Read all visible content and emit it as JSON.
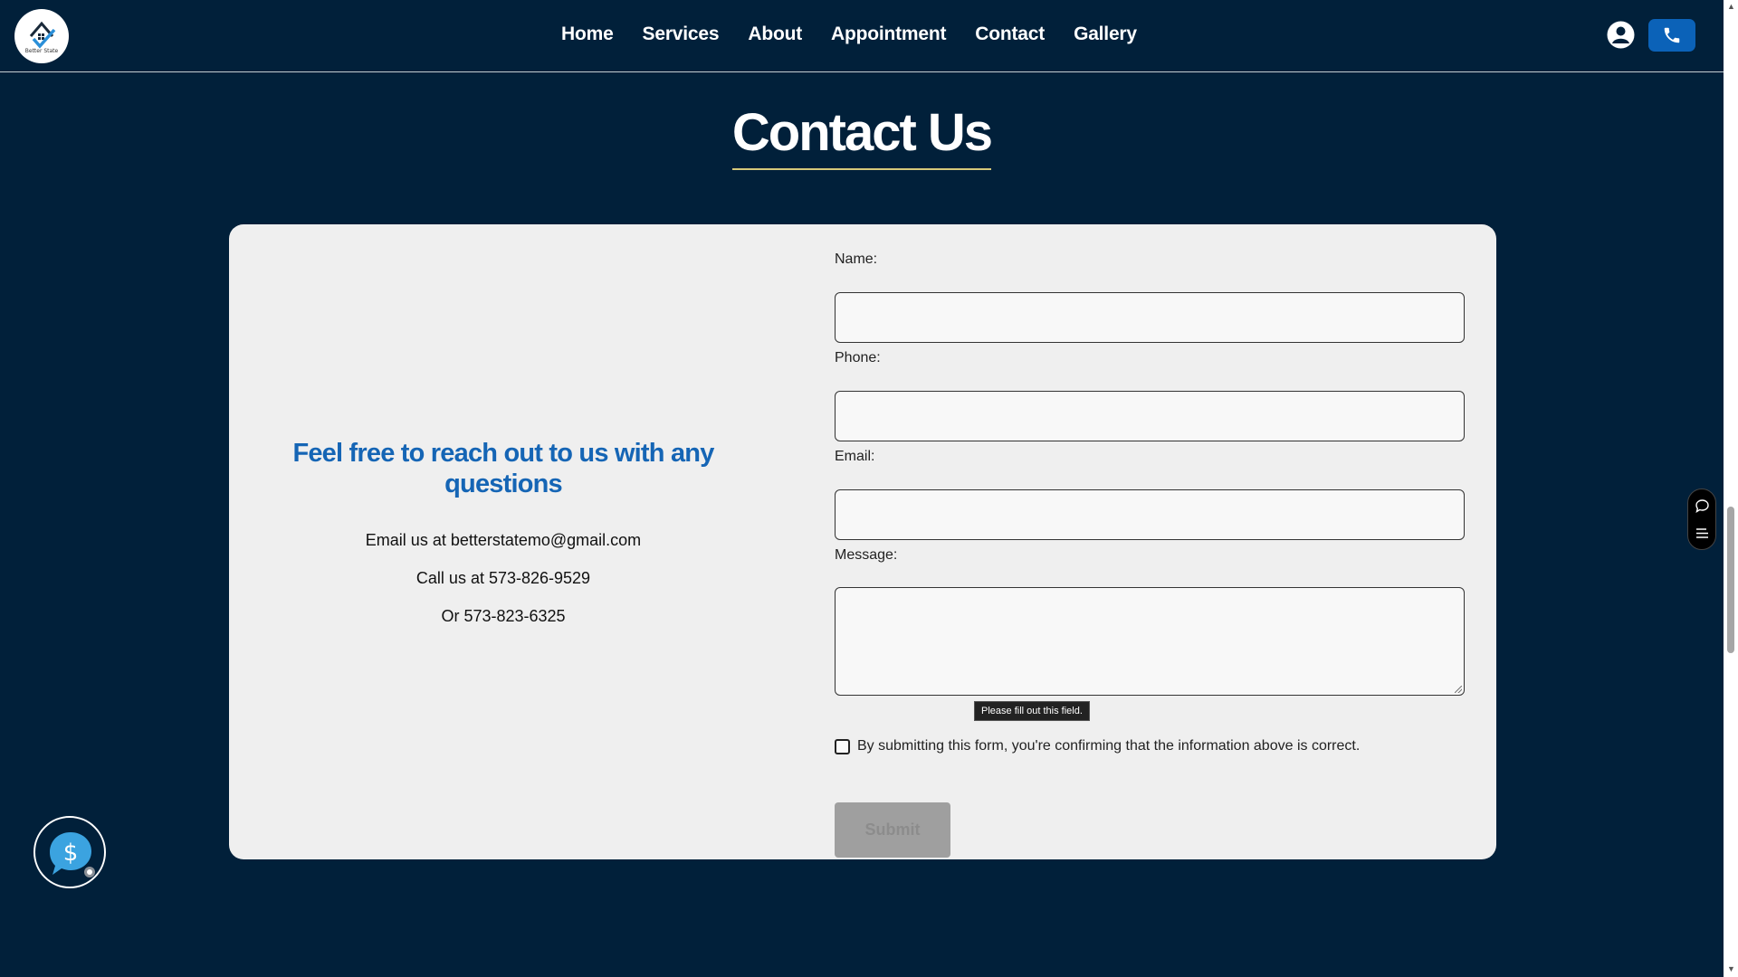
{
  "header": {
    "logo_text": "Better State",
    "nav": [
      "Home",
      "Services",
      "About",
      "Appointment",
      "Contact",
      "Gallery"
    ],
    "colors": {
      "background": "#01203a",
      "accent": "#0b62b8"
    },
    "icons": {
      "account": "account-circle-icon",
      "phone": "phone-icon"
    }
  },
  "page": {
    "title": "Contact Us"
  },
  "info": {
    "heading": "Feel free to reach out to us with any questions",
    "email_line": "Email us at betterstatemo@gmail.com",
    "phone_line": "Call us at 573-826-9529",
    "alt_phone_line": "Or 573-823-6325",
    "heading_color": "#1565b5"
  },
  "form": {
    "name_label": "Name:",
    "name_value": "",
    "phone_label": "Phone:",
    "phone_value": "",
    "email_label": "Email:",
    "email_value": "",
    "message_label": "Message:",
    "message_value": "",
    "validation_tooltip": "Please fill out this field.",
    "consent_text": "By submitting this form, you're confirming that the information above is correct.",
    "consent_checked": false,
    "submit_label": "Submit"
  },
  "widgets": {
    "chat_widget_icon": "dollar-chat-icon",
    "side_panel_icons": [
      "comment-icon",
      "list-icon"
    ]
  }
}
